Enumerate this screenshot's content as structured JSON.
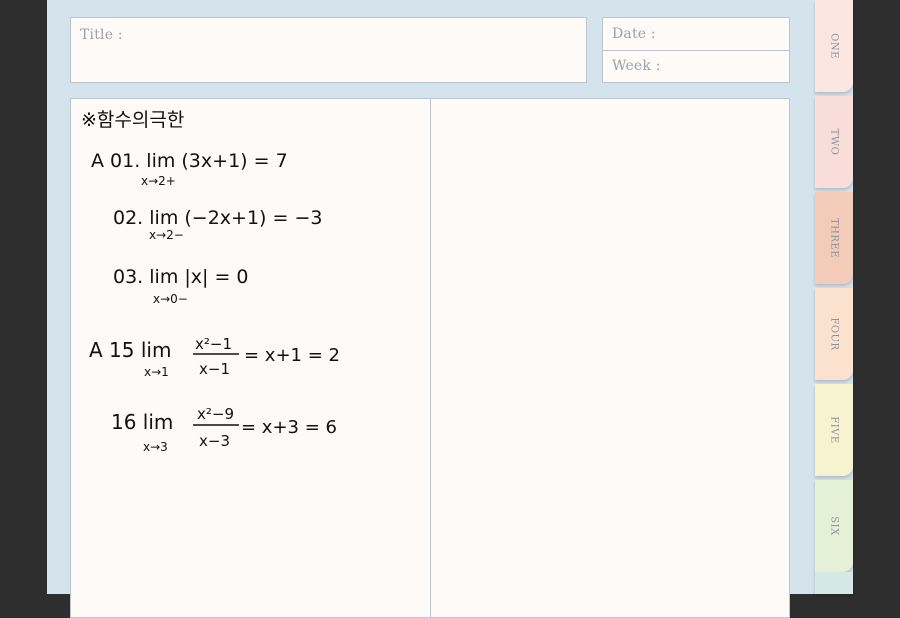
{
  "header": {
    "title_label": "Title :",
    "date_label": "Date :",
    "week_label": "Week :"
  },
  "notes": {
    "heading": "※함수의극한",
    "lines": [
      "A 01. lim (3x+1) = 7",
      "x→2+",
      "02. lim (−2x+1) = −3",
      "x→2−",
      "03. lim |x| = 0",
      "x→0−",
      "A 15 lim",
      "x²−1",
      "x−1",
      "= x+1 = 2",
      "x→1",
      "16 lim",
      "x²−9",
      "x−3",
      "= x+3 = 6",
      "x→3"
    ]
  },
  "tabs": [
    "ONE",
    "TWO",
    "THREE",
    "FOUR",
    "FIVE",
    "SIX"
  ],
  "colors": {
    "page_bg": "#d5e3ec",
    "paper": "#fefaf8",
    "tab_one": "#fbe6e1",
    "tab_two": "#f9ddd8",
    "tab_three": "#f4cbb8",
    "tab_four": "#fbe2cf",
    "tab_five": "#f7f3d1",
    "tab_six": "#e5f1d6"
  }
}
